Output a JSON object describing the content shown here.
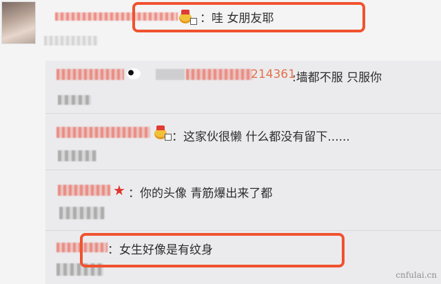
{
  "top_comment": {
    "text": "：哇  女朋友耶"
  },
  "replies": [
    {
      "username_partial": "214361",
      "text": ":墙都不服 只服你"
    },
    {
      "text": "：这家伙很懒 什么都没有留下......"
    },
    {
      "text": "：你的头像 青筋爆出来了都"
    },
    {
      "text": "：女生好像是有纹身"
    }
  ],
  "watermark": "cnfulai.cn",
  "colors": {
    "highlight": "#f0522f",
    "username": "#e6704a"
  }
}
